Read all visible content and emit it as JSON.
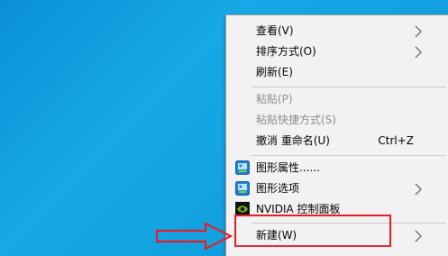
{
  "context_menu": {
    "items": [
      {
        "label": "查看(V)",
        "has_submenu": true,
        "disabled": false
      },
      {
        "label": "排序方式(O)",
        "has_submenu": true,
        "disabled": false
      },
      {
        "label": "刷新(E)",
        "has_submenu": false,
        "disabled": false
      },
      {
        "label": "粘贴(P)",
        "has_submenu": false,
        "disabled": true
      },
      {
        "label": "粘贴快捷方式(S)",
        "has_submenu": false,
        "disabled": true
      },
      {
        "label": "撤消 重命名(U)",
        "shortcut": "Ctrl+Z",
        "has_submenu": false,
        "disabled": false
      },
      {
        "label": "图形属性......",
        "icon": "intel-graphics-icon",
        "has_submenu": false,
        "disabled": false
      },
      {
        "label": "图形选项",
        "icon": "intel-graphics-icon",
        "has_submenu": true,
        "disabled": false
      },
      {
        "label": "NVIDIA 控制面板",
        "icon": "nvidia-icon",
        "has_submenu": false,
        "disabled": false
      },
      {
        "label": "新建(W)",
        "has_submenu": true,
        "disabled": false
      }
    ]
  },
  "annotation": {
    "color": "#e0202c"
  },
  "colors": {
    "desktop": "#13a4e2",
    "menu_bg": "#f2f2f2",
    "disabled_text": "#8d8d8d"
  }
}
